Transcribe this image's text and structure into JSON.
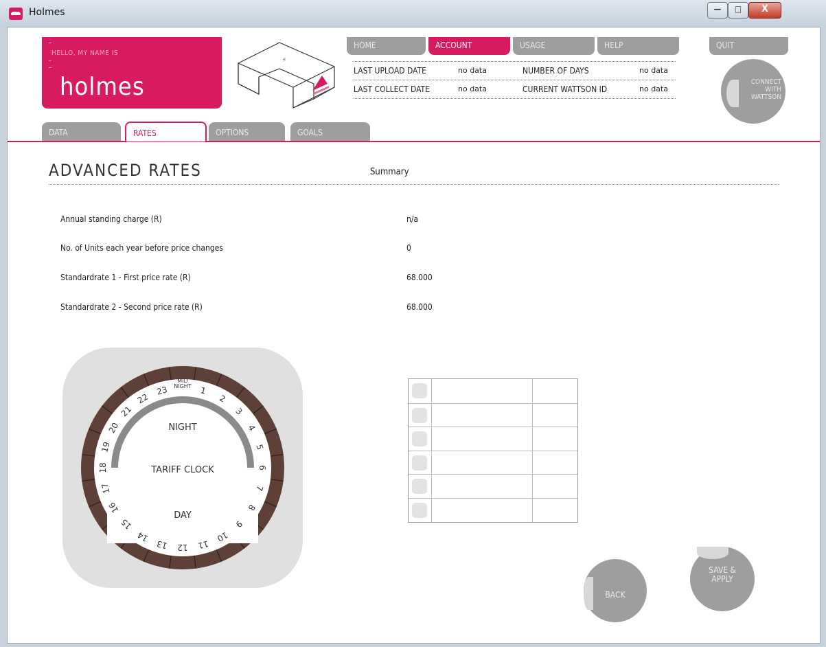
{
  "window": {
    "title": "Holmes",
    "controls": {
      "minimize": "—",
      "maximize": "□",
      "close": "X"
    }
  },
  "brand": {
    "greeting": "HELLO, MY NAME IS",
    "name": "holmes"
  },
  "nav": {
    "home": "HOME",
    "account": "ACCOUNT",
    "usage": "USAGE",
    "help": "HELP",
    "quit": "QUIT",
    "active": "ACCOUNT"
  },
  "info": {
    "last_upload_label": "LAST UPLOAD DATE",
    "last_upload_value": "no data",
    "last_collect_label": "LAST COLLECT DATE",
    "last_collect_value": "no data",
    "num_days_label": "NUMBER OF DAYS",
    "num_days_value": "no data",
    "wattson_id_label": "CURRENT WATTSON ID",
    "wattson_id_value": "no data"
  },
  "connect": {
    "line1": "CONNECT",
    "line2": "WITH",
    "line3": "WATTSON"
  },
  "tabs": {
    "data": "DATA",
    "rates": "RATES",
    "options": "OPTIONS",
    "goals": "GOALS",
    "active": "RATES"
  },
  "page": {
    "heading": "ADVANCED RATES",
    "summary": "Summary"
  },
  "rates": [
    {
      "label": "Annual standing charge (R)",
      "value": "n/a"
    },
    {
      "label": "No. of Units each year before price changes",
      "value": "0"
    },
    {
      "label": "Standardrate 1 - First price rate (R)",
      "value": "68.000"
    },
    {
      "label": "Standardrate 2 - Second price rate (R)",
      "value": "68.000"
    }
  ],
  "clock": {
    "center_label": "TARIFF CLOCK",
    "night_label": "NIGHT",
    "day_label": "DAY",
    "midnight_label": [
      "MID",
      "NIGHT"
    ],
    "hours": [
      "1",
      "2",
      "3",
      "4",
      "5",
      "6",
      "7",
      "8",
      "9",
      "10",
      "11",
      "12",
      "13",
      "14",
      "15",
      "16",
      "17",
      "18",
      "19",
      "20",
      "21",
      "22",
      "23"
    ],
    "colors": {
      "ring": "#5d4037",
      "night_arc": "#8a8a8a",
      "face": "#ffffff",
      "box": "#e0e0e0"
    }
  },
  "tariff_table": {
    "rows": 6
  },
  "buttons": {
    "back": "BACK",
    "save_line1": "SAVE &",
    "save_line2": "APPLY"
  },
  "colors": {
    "accent": "#d81b60",
    "button_grey": "#9e9e9e"
  }
}
